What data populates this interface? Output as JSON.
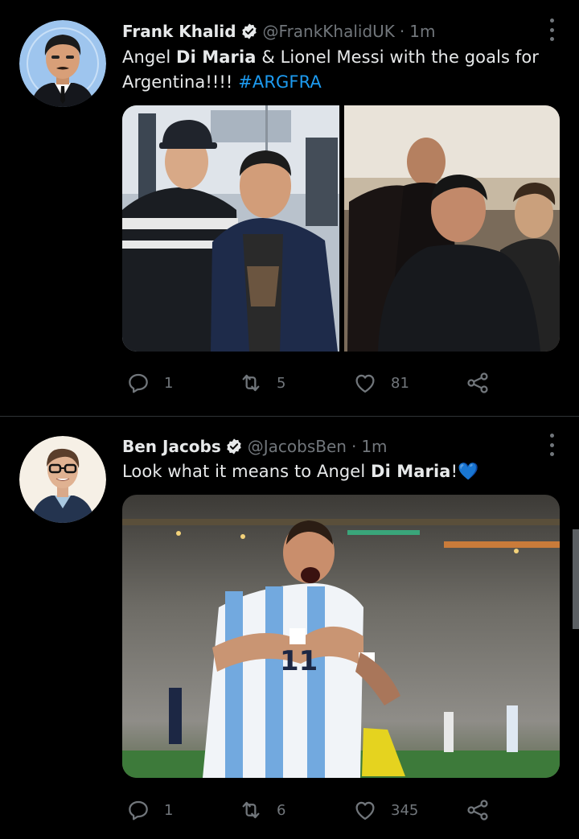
{
  "colors": {
    "background": "#000000",
    "text": "#e7e9ea",
    "muted": "#71767b",
    "accent": "#1d9bf0"
  },
  "tweets": [
    {
      "author": "Frank Khalid",
      "handle": "@FrankKhalidUK",
      "separator": "·",
      "time": "1m",
      "verified_icon": "verified-badge-icon",
      "text": {
        "t1": "Angel ",
        "b1": "Di Maria",
        "t2": " & Lionel Messi with the goals for Argentina!!!! ",
        "hashtag": "#ARGFRA"
      },
      "media_count": 2,
      "stats": {
        "replies": "1",
        "retweets": "5",
        "likes": "81"
      }
    },
    {
      "author": "Ben Jacobs",
      "handle": "@JacobsBen",
      "separator": "·",
      "time": "1m",
      "verified_icon": "verified-badge-icon",
      "text": {
        "t1": "Look what it means to Angel ",
        "b1": "Di Maria",
        "t2": "!",
        "emoji": "💙"
      },
      "media_count": 1,
      "stats": {
        "replies": "1",
        "retweets": "6",
        "likes": "345"
      }
    }
  ]
}
